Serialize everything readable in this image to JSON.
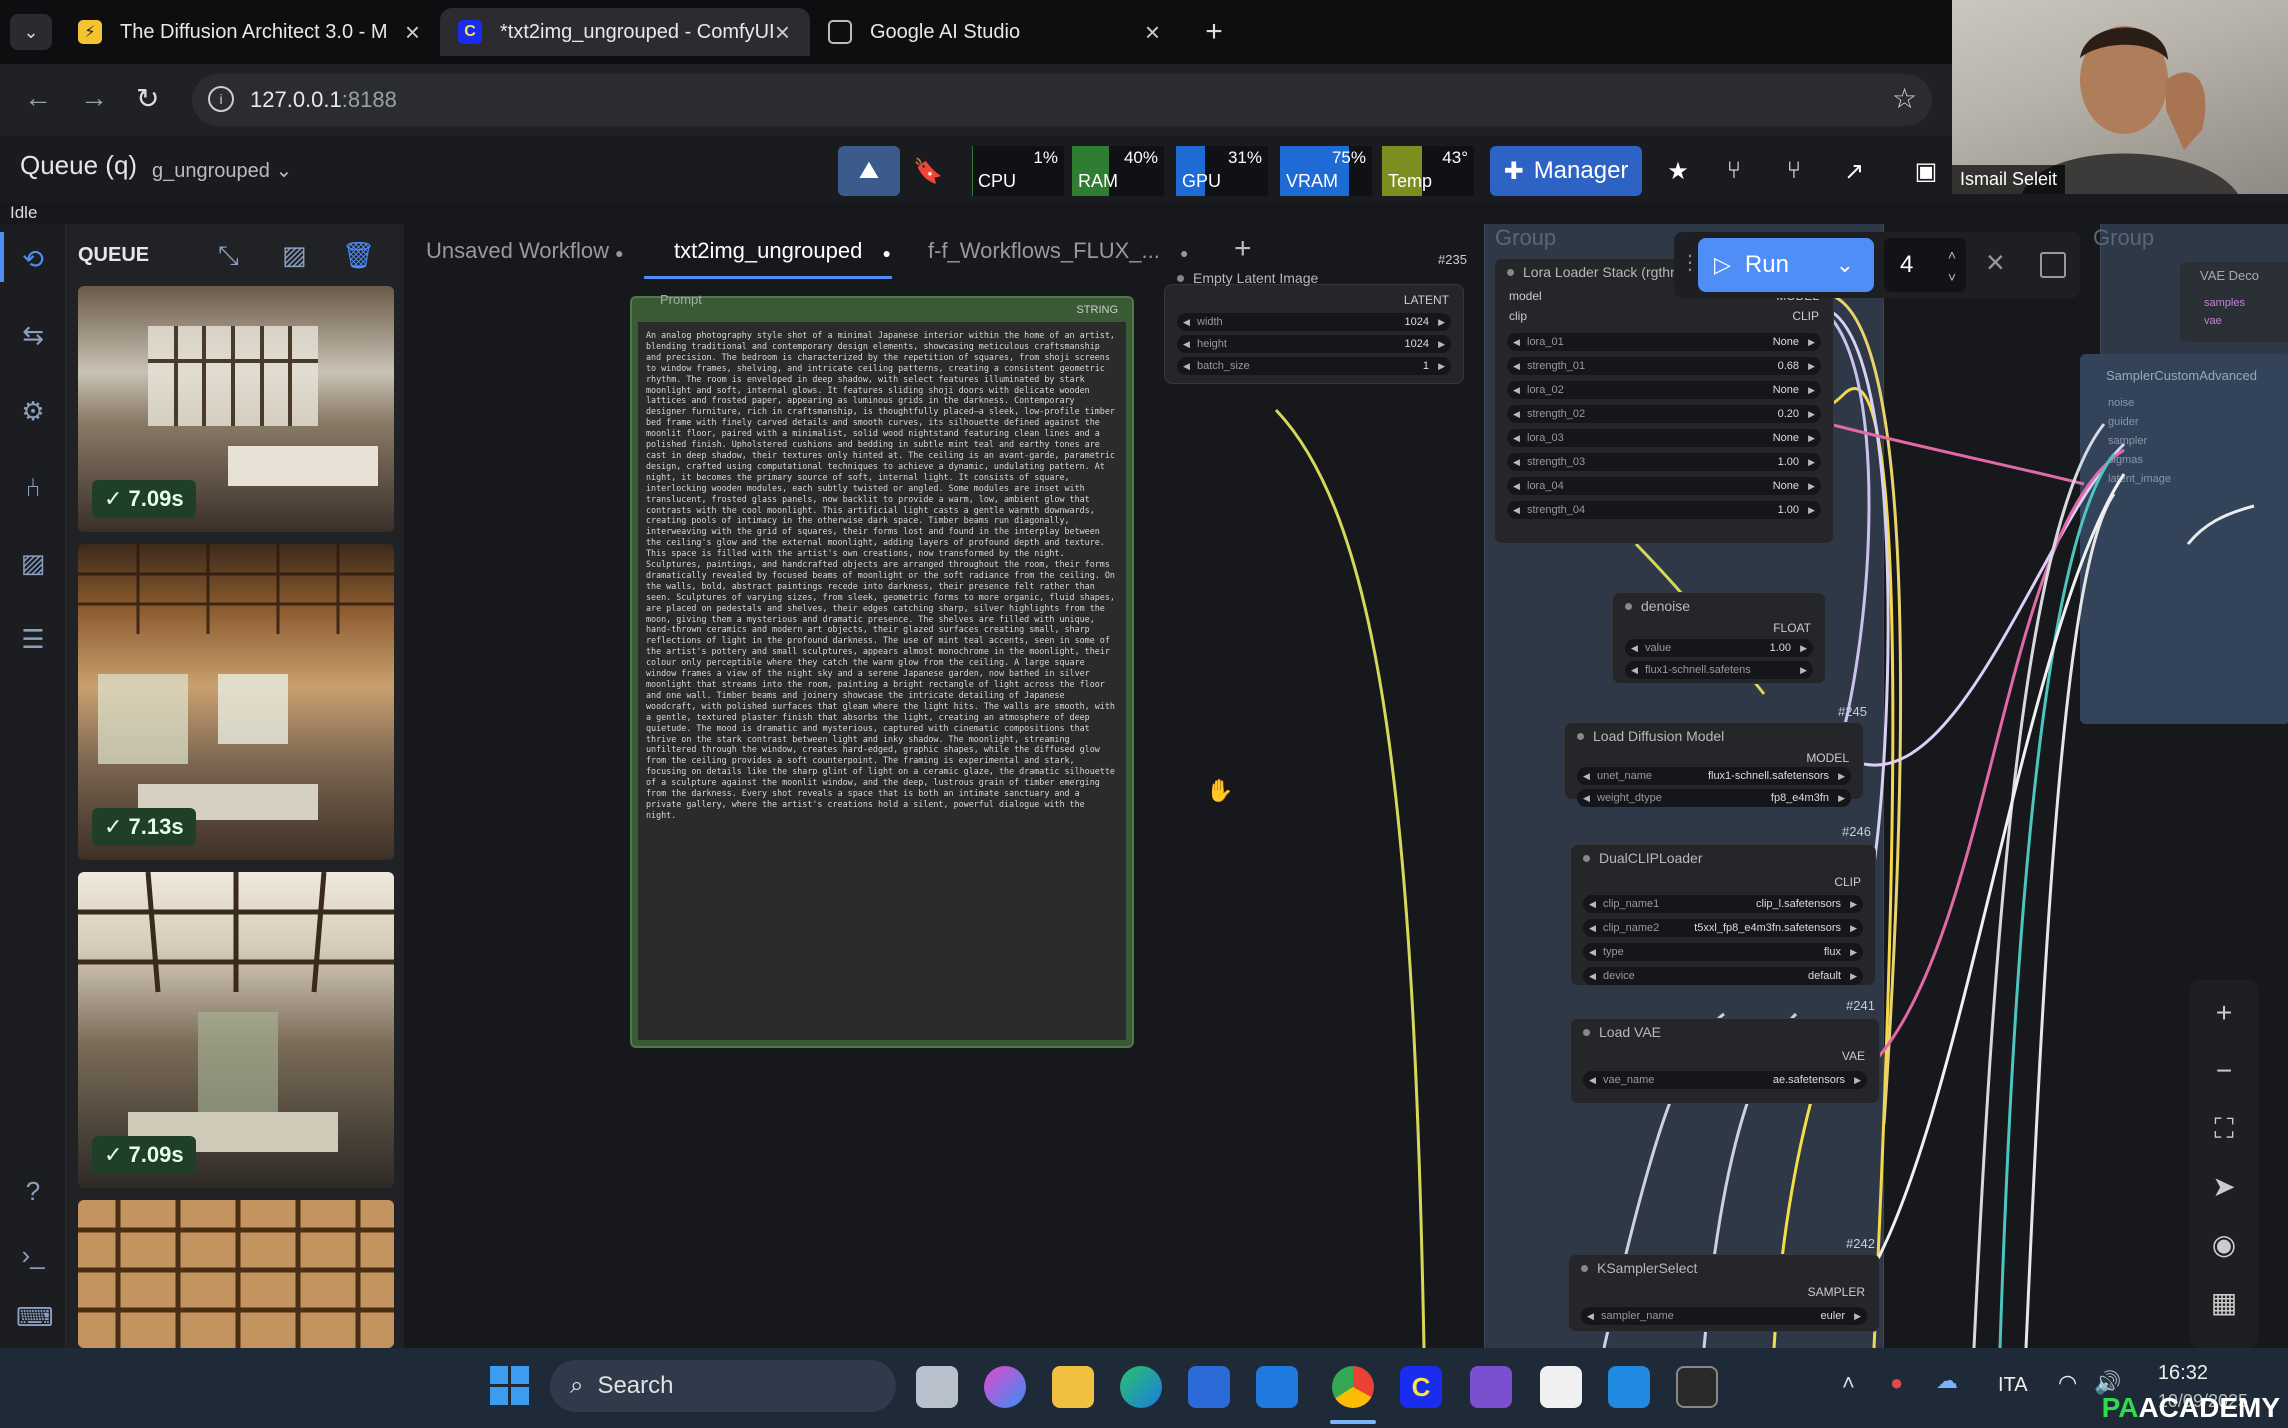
{
  "browser": {
    "tabs": [
      {
        "title": "The Diffusion Architect 3.0 - M",
        "icon": "bolt-icon"
      },
      {
        "title": "*txt2img_ungrouped - ComfyUI",
        "icon": "comfy-icon"
      },
      {
        "title": "Google AI Studio",
        "icon": "studio-icon"
      }
    ],
    "url_host": "127.0.0.1",
    "url_port": ":8188"
  },
  "menu": {
    "queue_label": "Queue (q)",
    "workflow_name": "g_ungrouped",
    "stats": [
      {
        "label": "CPU",
        "value": "1%",
        "level": 0.01,
        "color": "#2f7d32"
      },
      {
        "label": "RAM",
        "value": "40%",
        "level": 0.4,
        "color": "#2f7d32"
      },
      {
        "label": "GPU",
        "value": "31%",
        "level": 0.31,
        "color": "#1e6bd6"
      },
      {
        "label": "VRAM",
        "value": "75%",
        "level": 0.75,
        "color": "#1e6bd6"
      },
      {
        "label": "Temp",
        "value": "43°",
        "level": 0.43,
        "color": "#7d8d1f"
      }
    ],
    "manager_label": "Manager",
    "status": "Idle"
  },
  "queue": {
    "title": "QUEUE",
    "items": [
      {
        "time": "✓ 7.09s"
      },
      {
        "time": "✓ 7.13s"
      },
      {
        "time": "✓ 7.09s"
      },
      {
        "time": ""
      }
    ]
  },
  "workflow_tabs": [
    "Unsaved Workflow",
    "txt2img_ungrouped",
    "f-f_Workflows_FLUX_..."
  ],
  "run": {
    "label": "Run",
    "count": "4"
  },
  "nodes": {
    "prompt": {
      "title": "Prompt",
      "output": "STRING",
      "text": "An analog photography style shot of a minimal Japanese interior within the home of an artist, blending traditional and contemporary design elements, showcasing meticulous craftsmanship and precision. The bedroom is characterized by the repetition of squares, from shoji screens to window frames, shelving, and intricate ceiling patterns, creating a consistent geometric rhythm. The room is enveloped in deep shadow, with select features illuminated by stark moonlight and soft, internal glows. It features sliding shoji doors with delicate wooden lattices and frosted paper, appearing as luminous grids in the darkness. Contemporary designer furniture, rich in craftsmanship, is thoughtfully placed—a sleek, low-profile timber bed frame with finely carved details and smooth curves, its silhouette defined against the moonlit floor, paired with a minimalist, solid wood nightstand featuring clean lines and a polished finish. Upholstered cushions and bedding in subtle mint teal and earthy tones are cast in deep shadow, their textures only hinted at. The ceiling is an avant-garde, parametric design, crafted using computational techniques to achieve a dynamic, undulating pattern. At night, it becomes the primary source of soft, internal light. It consists of square, interlocking wooden modules, each subtly twisted or angled. Some modules are inset with translucent, frosted glass panels, now backlit to provide a warm, low, ambient glow that contrasts with the cool moonlight. This artificial light casts a gentle warmth downwards, creating pools of intimacy in the otherwise dark space. Timber beams run diagonally, interweaving with the grid of squares, their forms lost and found in the interplay between the ceiling's glow and the external moonlight, adding layers of profound depth and texture. This space is filled with the artist's own creations, now transformed by the night. Sculptures, paintings, and handcrafted objects are arranged throughout the room, their forms dramatically revealed by focused beams of moonlight or the soft radiance from the ceiling. On the walls, bold, abstract paintings recede into darkness, their presence felt rather than seen. Sculptures of varying sizes, from sleek, geometric forms to more organic, fluid shapes, are placed on pedestals and shelves, their edges catching sharp, silver highlights from the moon, giving them a mysterious and dramatic presence. The shelves are filled with unique, hand-thrown ceramics and modern art objects, their glazed surfaces creating small, sharp reflections of light in the profound darkness. The use of mint teal accents, seen in some of the artist's pottery and small sculptures, appears almost monochrome in the moonlight, their colour only perceptible where they catch the warm glow from the ceiling. A large square window frames a view of the night sky and a serene Japanese garden, now bathed in silver moonlight that streams into the room, painting a bright rectangle of light across the floor and one wall. Timber beams and joinery showcase the intricate detailing of Japanese woodcraft, with polished surfaces that gleam where the light hits. The walls are smooth, with a gentle, textured plaster finish that absorbs the light, creating an atmosphere of deep quietude. The mood is dramatic and mysterious, captured with cinematic compositions that thrive on the stark contrast between light and inky shadow. The moonlight, streaming unfiltered through the window, creates hard-edged, graphic shapes, while the diffused glow from the ceiling provides a soft counterpoint. The framing is experimental and stark, focusing on details like the sharp glint of light on a ceramic glaze, the dramatic silhouette of a sculpture against the moonlit window, and the deep, lustrous grain of timber emerging from the darkness. Every shot reveals a space that is both an intimate sanctuary and a private gallery, where the artist's creations hold a silent, powerful dialogue with the night."
    },
    "empty_latent": {
      "title": "Empty Latent Image",
      "output": "LATENT",
      "widgets": [
        {
          "name": "width",
          "value": "1024"
        },
        {
          "name": "height",
          "value": "1024"
        },
        {
          "name": "batch_size",
          "value": "1"
        }
      ]
    },
    "lora_stack": {
      "title": "Lora Loader Stack (rgthree)",
      "inputs": [
        "model",
        "clip"
      ],
      "outputs": [
        "MODEL",
        "CLIP"
      ],
      "widgets": [
        {
          "name": "lora_01",
          "value": "None"
        },
        {
          "name": "strength_01",
          "value": "0.68"
        },
        {
          "name": "lora_02",
          "value": "None"
        },
        {
          "name": "strength_02",
          "value": "0.20"
        },
        {
          "name": "lora_03",
          "value": "None"
        },
        {
          "name": "strength_03",
          "value": "1.00"
        },
        {
          "name": "lora_04",
          "value": "None"
        },
        {
          "name": "strength_04",
          "value": "1.00"
        }
      ]
    },
    "denoise": {
      "title": "denoise",
      "output": "FLOAT",
      "widgets": [
        {
          "name": "value",
          "value": "1.00"
        },
        {
          "name": "",
          "value": "flux1-schnell.safetens"
        }
      ]
    },
    "load_diffusion": {
      "title": "Load Diffusion Model",
      "id": "#245",
      "output": "MODEL",
      "widgets": [
        {
          "name": "unet_name",
          "value": "flux1-schnell.safetensors"
        },
        {
          "name": "weight_dtype",
          "value": "fp8_e4m3fn"
        }
      ]
    },
    "dual_clip": {
      "title": "DualCLIPLoader",
      "id": "#246",
      "output": "CLIP",
      "widgets": [
        {
          "name": "clip_name1",
          "value": "clip_l.safetensors"
        },
        {
          "name": "clip_name2",
          "value": "t5xxl_fp8_e4m3fn.safetensors"
        },
        {
          "name": "type",
          "value": "flux"
        },
        {
          "name": "device",
          "value": "default"
        }
      ]
    },
    "load_vae": {
      "title": "Load VAE",
      "id": "#241",
      "output": "VAE",
      "widgets": [
        {
          "name": "vae_name",
          "value": "ae.safetensors"
        }
      ]
    },
    "ksampler_select": {
      "title": "KSamplerSelect",
      "id": "#242",
      "output": "SAMPLER",
      "widgets": [
        {
          "name": "sampler_name",
          "value": "euler"
        }
      ]
    },
    "sampler_custom": {
      "title": "SamplerCustomAdvanced",
      "inputs": [
        "noise",
        "guider",
        "sampler",
        "sigmas",
        "latent_image"
      ]
    },
    "vae_decode": {
      "title": "VAE Deco",
      "inputs": [
        "samples",
        "vae"
      ]
    },
    "node_235": "#235"
  },
  "groups": [
    "Group",
    "Group"
  ],
  "taskbar": {
    "search": "Search",
    "lang": "ITA",
    "time": "16:32",
    "date": "10/09/2025"
  },
  "webcam": {
    "name": "Ismail Seleit"
  },
  "watermark": {
    "pa": "PA",
    "rest": "ACADEMY"
  }
}
